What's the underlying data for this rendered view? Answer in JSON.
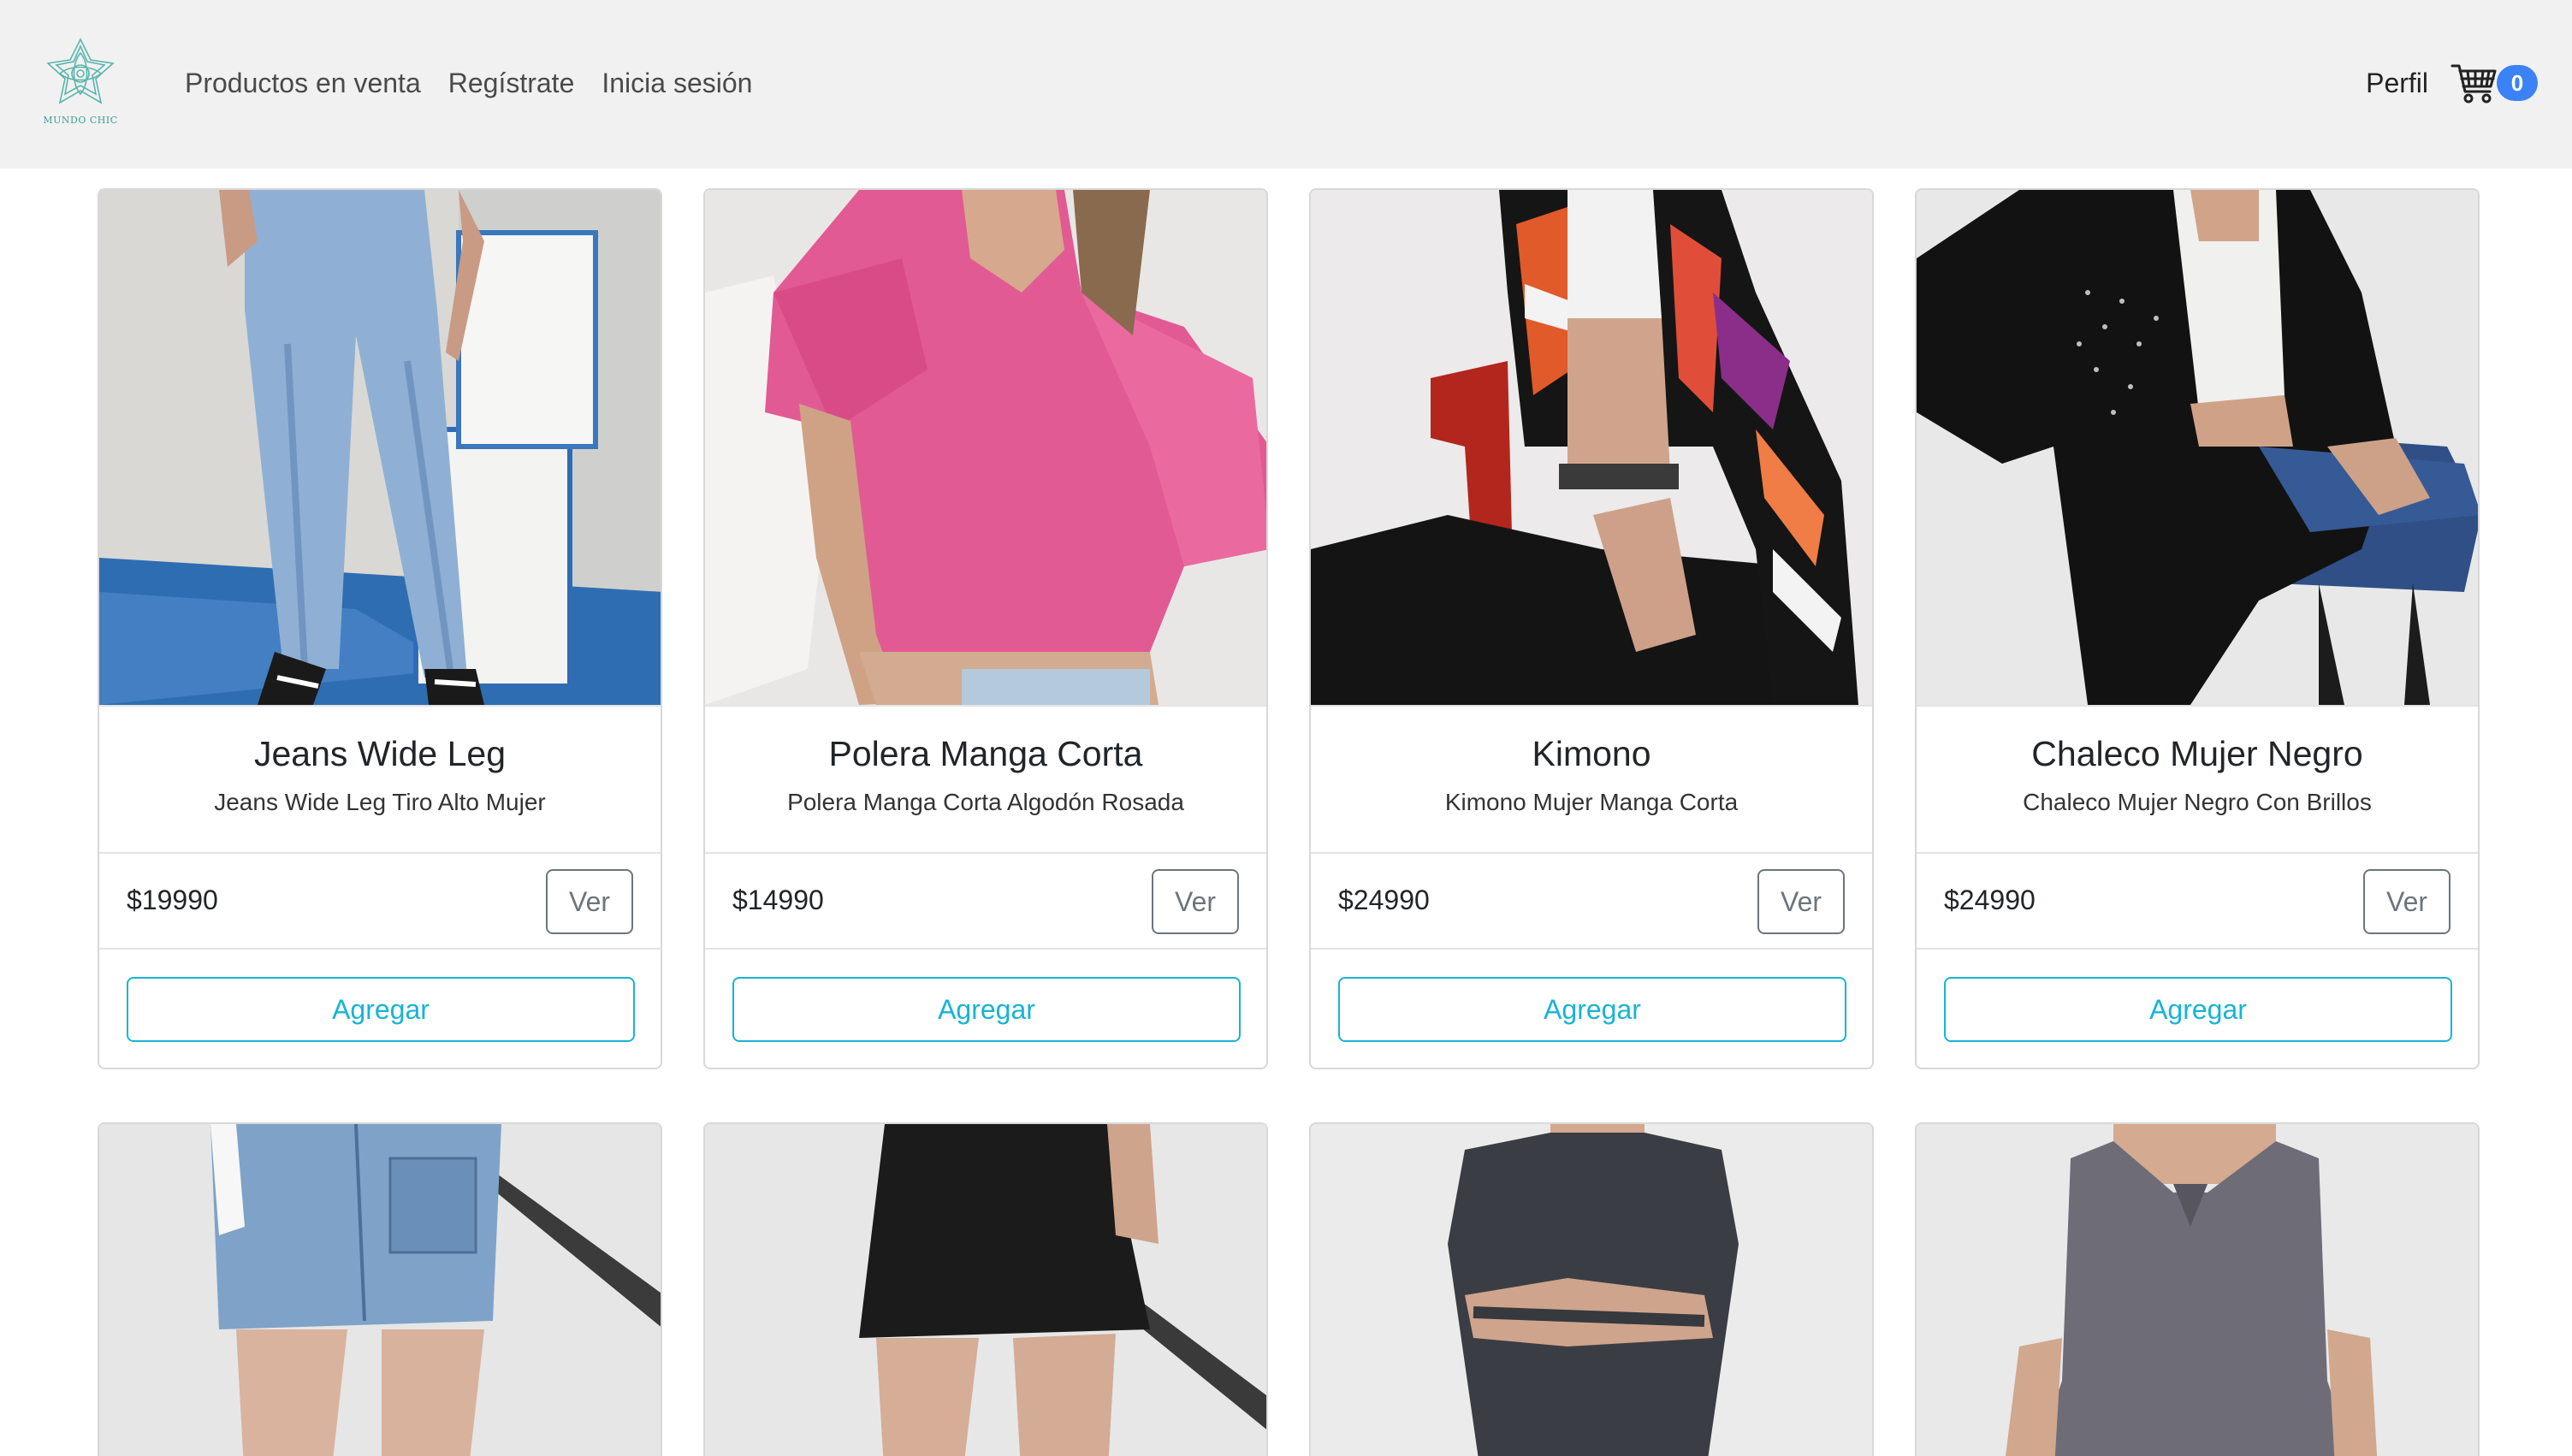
{
  "brand": {
    "logo_text": "MUNDO CHIC"
  },
  "nav": {
    "links": [
      "Productos en venta",
      "Regístrate",
      "Inicia sesión"
    ],
    "profile": "Perfil",
    "cart_count": "0"
  },
  "colors": {
    "accent": "#17b4d4",
    "badge": "#3b82f6",
    "nav_bg": "#f1f1f1"
  },
  "products": [
    {
      "title": "Jeans Wide Leg",
      "desc": "Jeans Wide Leg Tiro Alto Mujer",
      "price": "$19990",
      "view": "Ver",
      "add": "Agregar",
      "image": "jeans-photo"
    },
    {
      "title": "Polera Manga Corta",
      "desc": "Polera Manga Corta Algodón Rosada",
      "price": "$14990",
      "view": "Ver",
      "add": "Agregar",
      "image": "pink-top-photo"
    },
    {
      "title": "Kimono",
      "desc": "Kimono Mujer Manga Corta",
      "price": "$24990",
      "view": "Ver",
      "add": "Agregar",
      "image": "kimono-photo"
    },
    {
      "title": "Chaleco Mujer Negro",
      "desc": "Chaleco Mujer Negro Con Brillos",
      "price": "$24990",
      "view": "Ver",
      "add": "Agregar",
      "image": "black-cardigan-photo"
    }
  ],
  "products_row2": [
    {
      "image": "denim-skirt-photo"
    },
    {
      "image": "black-skort-photo"
    },
    {
      "image": "grey-dress-photo"
    },
    {
      "image": "grey-jumpsuit-photo"
    }
  ]
}
